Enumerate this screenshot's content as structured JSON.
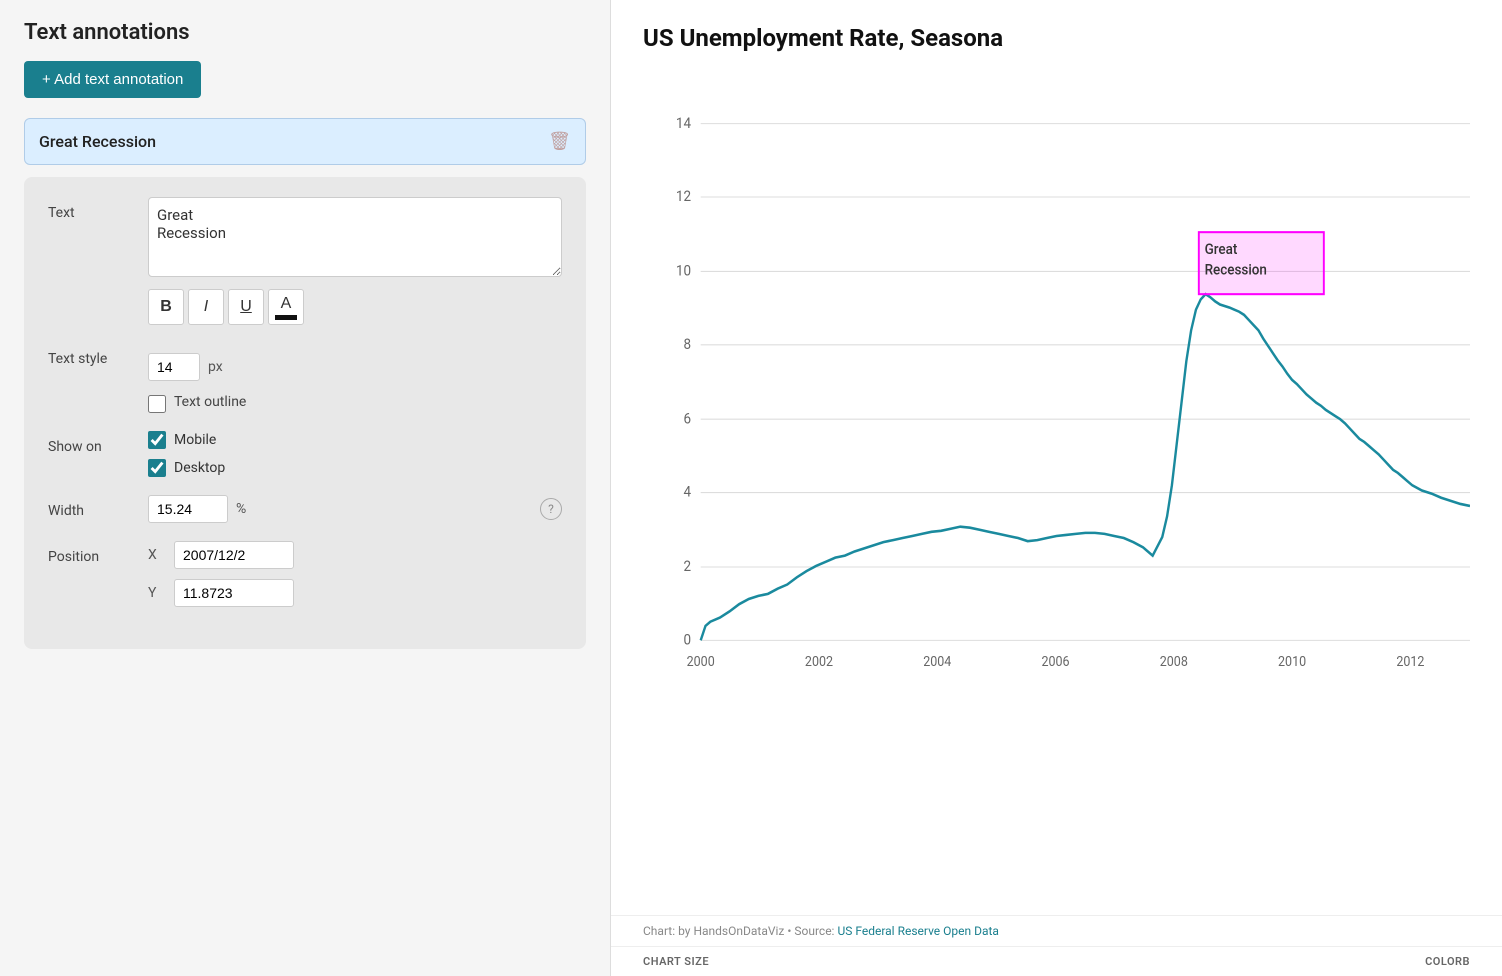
{
  "page": {
    "title": "Text annotations"
  },
  "toolbar": {
    "add_button_label": "+ Add text annotation"
  },
  "annotation_item": {
    "label": "Great Recession",
    "delete_tooltip": "Delete"
  },
  "form": {
    "text_label": "Text",
    "text_value": "Great\nRecession",
    "text_style_label": "Text style",
    "font_size": "14",
    "font_size_unit": "px",
    "outline_label": "Text outline",
    "show_on_label": "Show on",
    "mobile_label": "Mobile",
    "desktop_label": "Desktop",
    "mobile_checked": true,
    "desktop_checked": true,
    "width_label": "Width",
    "width_value": "15.24",
    "width_unit": "%",
    "position_label": "Position",
    "x_label": "X",
    "x_value": "2007/12/2",
    "y_label": "Y",
    "y_value": "11.8723",
    "format_bold": "B",
    "format_italic": "I",
    "format_underline": "U",
    "format_color": "A"
  },
  "chart": {
    "title": "US Unemployment Rate, Seasona",
    "annotation_text": "Great\nRecession",
    "source_prefix": "Chart: by HandsOnDataViz • Source: ",
    "source_link_text": "US Federal Reserve Open Data",
    "source_link_url": "#",
    "y_axis_labels": [
      "0",
      "2",
      "4",
      "6",
      "8",
      "10",
      "12",
      "14"
    ],
    "x_axis_labels": [
      "2000",
      "2002",
      "2004",
      "2006",
      "2008",
      "2010",
      "2012"
    ],
    "bottom_left": "CHART SIZE",
    "bottom_right": "COLORB"
  }
}
